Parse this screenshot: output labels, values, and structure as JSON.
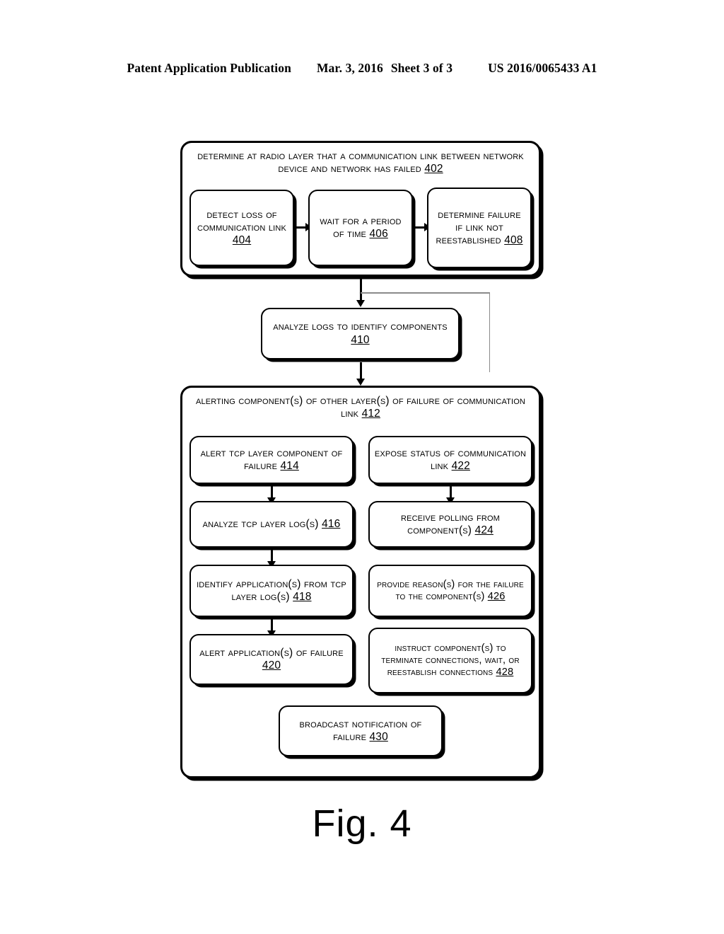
{
  "header": {
    "publication": "Patent Application Publication",
    "date": "Mar. 3, 2016",
    "sheet": "Sheet 3 of 3",
    "patent_number": "US 2016/0065433 A1"
  },
  "figure": {
    "caption": "Fig. 4",
    "stage_402": {
      "title": "Determine at Radio Layer that a Communication Link Between Network Device and Network has Failed",
      "ref": "402",
      "steps": [
        {
          "text": "Detect Loss of Communication Link",
          "ref": "404"
        },
        {
          "text": "Wait for a Period of Time",
          "ref": "406"
        },
        {
          "text": "Determine Failure if Link not Reestablished",
          "ref": "408"
        }
      ]
    },
    "stage_410": {
      "text": "Analyze Logs to Identify Components",
      "ref": "410"
    },
    "stage_412": {
      "title": "Alerting Component(s) of Other Layer(s) of Failure of Communication Link",
      "ref": "412",
      "left_column": [
        {
          "text": "Alert TCP Layer Component of Failure",
          "ref": "414"
        },
        {
          "text": "Analyze TCP Layer Log(s)",
          "ref": "416"
        },
        {
          "text": "Identify Application(s) from TCP Layer Log(s)",
          "ref": "418"
        },
        {
          "text": "Alert Application(s) of Failure",
          "ref": "420"
        }
      ],
      "right_column": [
        {
          "text": "Expose Status of Communication Link",
          "ref": "422"
        },
        {
          "text": "Receive Polling from Component(s)",
          "ref": "424"
        },
        {
          "text": "Provide Reason(s) for the Failure to the Component(s)",
          "ref": "426"
        },
        {
          "text": "Instruct Component(s) to Terminate Connections, Wait, or Reestablish Connections",
          "ref": "428"
        }
      ],
      "bottom": {
        "text": "Broadcast Notification of Failure",
        "ref": "430"
      }
    }
  }
}
